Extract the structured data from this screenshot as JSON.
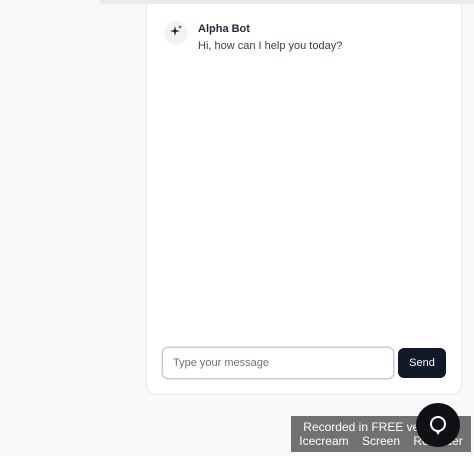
{
  "chat": {
    "messages": [
      {
        "sender": "Alpha Bot",
        "text": "Hi, how can I help you today?",
        "avatar_icon": "sparkle-icon"
      }
    ],
    "input": {
      "placeholder": "Type your message",
      "value": ""
    },
    "send_label": "Send"
  },
  "watermark": {
    "line1": "Recorded in FREE version of",
    "line2": "Icecream Screen Recorder"
  },
  "colors": {
    "send_button": "#111827",
    "panel_background": "#ffffff",
    "page_background": "#f8f9fb"
  }
}
